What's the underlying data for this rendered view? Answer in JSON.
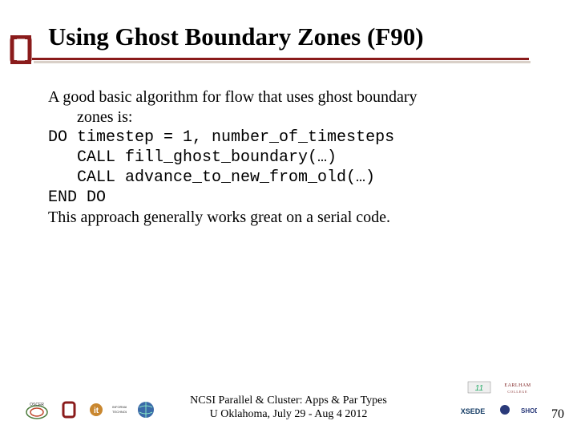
{
  "title": "Using Ghost Boundary Zones (F90)",
  "body": {
    "intro_l1": "A good basic algorithm for flow that uses ghost boundary",
    "intro_l2": "zones is:",
    "code_l1": "DO timestep = 1, number_of_timesteps",
    "code_l2": "CALL fill_ghost_boundary(…)",
    "code_l3": "CALL advance_to_new_from_old(…)",
    "code_l4": "END DO",
    "outro": "This approach generally works great on a serial code."
  },
  "footer": {
    "line1": "NCSI Parallel & Cluster: Apps & Par Types",
    "line2": "U Oklahoma, July 29 - Aug 4 2012"
  },
  "page_number": "70",
  "logos": {
    "ou_main": "OU-logo",
    "left": [
      "oscer-logo",
      "ou-small-logo",
      "ou-it-logo",
      "globe-logo"
    ],
    "right_top": [
      "sc-logo",
      "earlham-logo"
    ],
    "right_bottom": [
      "xsede-logo",
      "shodor-logo"
    ]
  },
  "colors": {
    "crimson": "#8a1b1b"
  }
}
